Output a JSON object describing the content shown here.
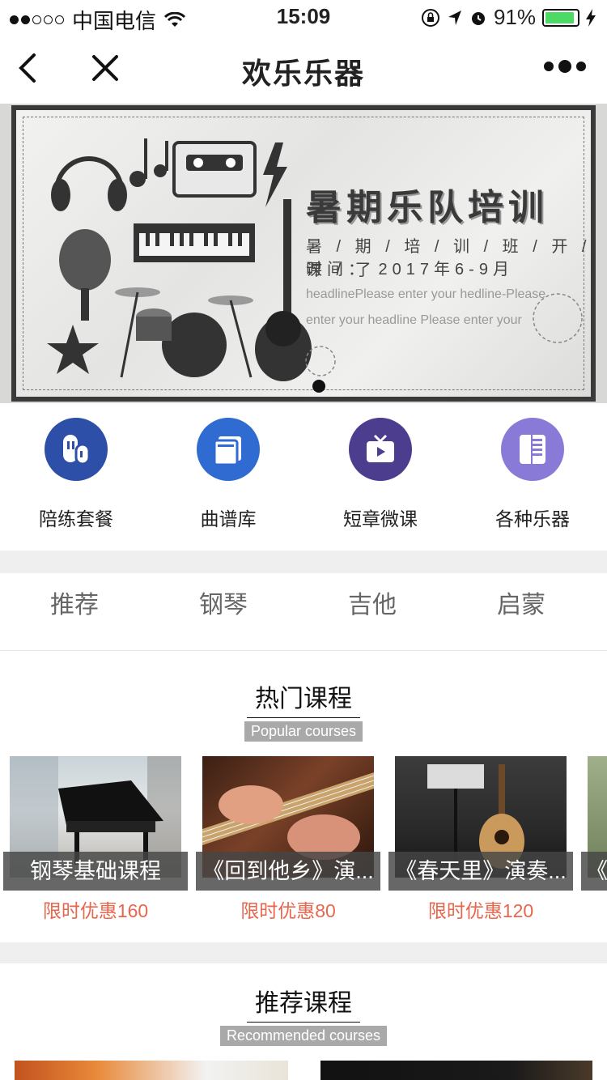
{
  "status_bar": {
    "carrier": "中国电信",
    "time": "15:09",
    "battery": "91%",
    "battery_level": 0.91
  },
  "nav": {
    "title": "欢乐乐器"
  },
  "banner": {
    "title": "暑期乐队培训",
    "subtitle": "暑 / 期 / 培 / 训 / 班 / 开 / 课 / 了",
    "date": "时间： 2017年6-9月",
    "placeholder_text": "headlinePlease enter your hedline-Please enter your headline Please enter your"
  },
  "quick_entries": [
    {
      "label": "陪练套餐",
      "icon": "duet-icon",
      "color": "#2d4fa8"
    },
    {
      "label": "曲谱库",
      "icon": "sheet-music-icon",
      "color": "#2f6bd0"
    },
    {
      "label": "短章微课",
      "icon": "video-icon",
      "color": "#4c3d8f"
    },
    {
      "label": "各种乐器",
      "icon": "keyboard-icon",
      "color": "#8a7ad8"
    }
  ],
  "category_tabs": [
    "推荐",
    "钢琴",
    "吉他",
    "启蒙"
  ],
  "hot_section": {
    "title": "热门课程",
    "subtitle": "Popular courses"
  },
  "hot_courses": [
    {
      "name": "钢琴基础课程",
      "price": "限时优惠160"
    },
    {
      "name": "《回到他乡》演...",
      "price": "限时优惠80"
    },
    {
      "name": "《春天里》演奏...",
      "price": "限时优惠120"
    },
    {
      "name": "《",
      "price": ""
    }
  ],
  "recommended_section": {
    "title": "推荐课程",
    "subtitle": "Recommended courses"
  }
}
